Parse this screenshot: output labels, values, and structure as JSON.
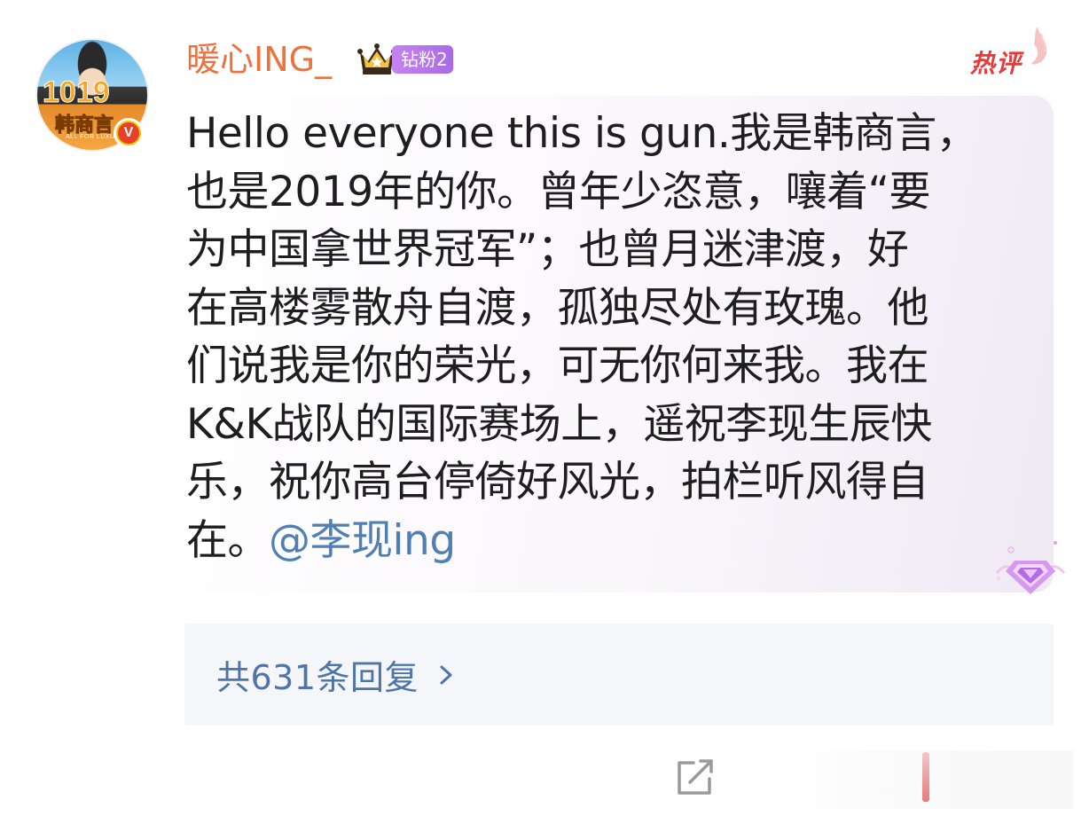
{
  "user": {
    "name": "暖心ING_",
    "fan_badge": "钻粉2",
    "avatar_number": "1019",
    "avatar_banner": "韩商言",
    "avatar_caption": "ALL FOR LUXURY",
    "verified_mark": "V"
  },
  "comment": {
    "tag": "热评",
    "lines": [
      "Hello everyone this is gun.我是韩商言，",
      "也是2019年的你。曾年少恣意，嚷着“要",
      "为中国拿世界冠军”；也曾月迷津渡，好",
      "在高楼雾散舟自渡，孤独尽处有玫瑰。他",
      "们说我是你的荣光，可无你何来我。我在",
      "K&K战队的国际赛场上，遥祝李现生辰快",
      "乐，祝你高台停倚好风光，拍栏听风得自"
    ],
    "last_line_prefix": "在。",
    "mention": "@李现ing"
  },
  "replies": {
    "label": "共631条回复"
  },
  "colors": {
    "username": "#eb7340",
    "mention": "#4f7fb5",
    "replies_text": "#4e75a8",
    "hot_tag": "#e63b3b",
    "badge": "#b076ea"
  },
  "icons": {
    "crown": "crown-icon",
    "verified": "verified-icon",
    "hot": "flame-icon",
    "gem": "diamond-gem-icon",
    "chevron": "chevron-right-icon",
    "share": "share-edit-icon"
  }
}
